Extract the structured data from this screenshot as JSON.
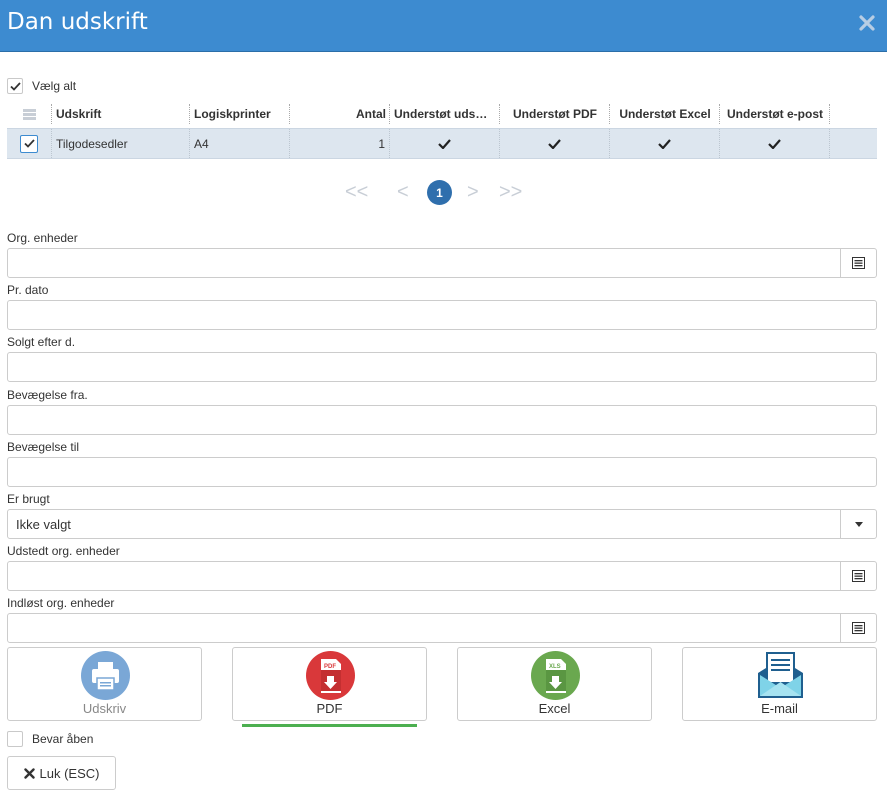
{
  "dialog": {
    "title": "Dan udskrift"
  },
  "select_all": {
    "label": "Vælg alt",
    "checked": true
  },
  "grid": {
    "columns": [
      "Udskrift",
      "Logiskprinter",
      "Antal",
      "Understøt uds…",
      "Understøt PDF",
      "Understøt Excel",
      "Understøt e-post"
    ],
    "rows": [
      {
        "name": "Tilgodesedler",
        "printer": "A4",
        "count": "1",
        "checked": true
      }
    ]
  },
  "pager": {
    "first": "<<",
    "prev": "<",
    "current": "1",
    "next": ">",
    "last": ">>"
  },
  "fields": [
    {
      "label": "Org. enheder",
      "value": ""
    },
    {
      "label": "Pr. dato",
      "value": ""
    },
    {
      "label": "Solgt efter d.",
      "value": ""
    },
    {
      "label": "Bevægelse fra.",
      "value": ""
    },
    {
      "label": "Bevægelse til",
      "value": ""
    },
    {
      "label": "Er brugt",
      "value": "Ikke valgt"
    },
    {
      "label": "Udstedt org. enheder",
      "value": ""
    },
    {
      "label": "Indløst org. enheder",
      "value": ""
    }
  ],
  "actions": {
    "print": "Udskriv",
    "pdf": "PDF",
    "excel": "Excel",
    "email": "E-mail"
  },
  "icon_text": {
    "pdf": "PDF",
    "xls": "XLS"
  },
  "keep_open": {
    "label": "Bevar åben",
    "checked": false
  },
  "close_button": {
    "label": "Luk (ESC)"
  },
  "colors": {
    "header": "#3d8bd0",
    "selected_row": "#dde6ef",
    "pager_active": "#2f6fad",
    "pdf": "#d9383a",
    "excel": "#6aa84f",
    "print": "#7aa7d6",
    "active_tab": "#4caf50"
  }
}
